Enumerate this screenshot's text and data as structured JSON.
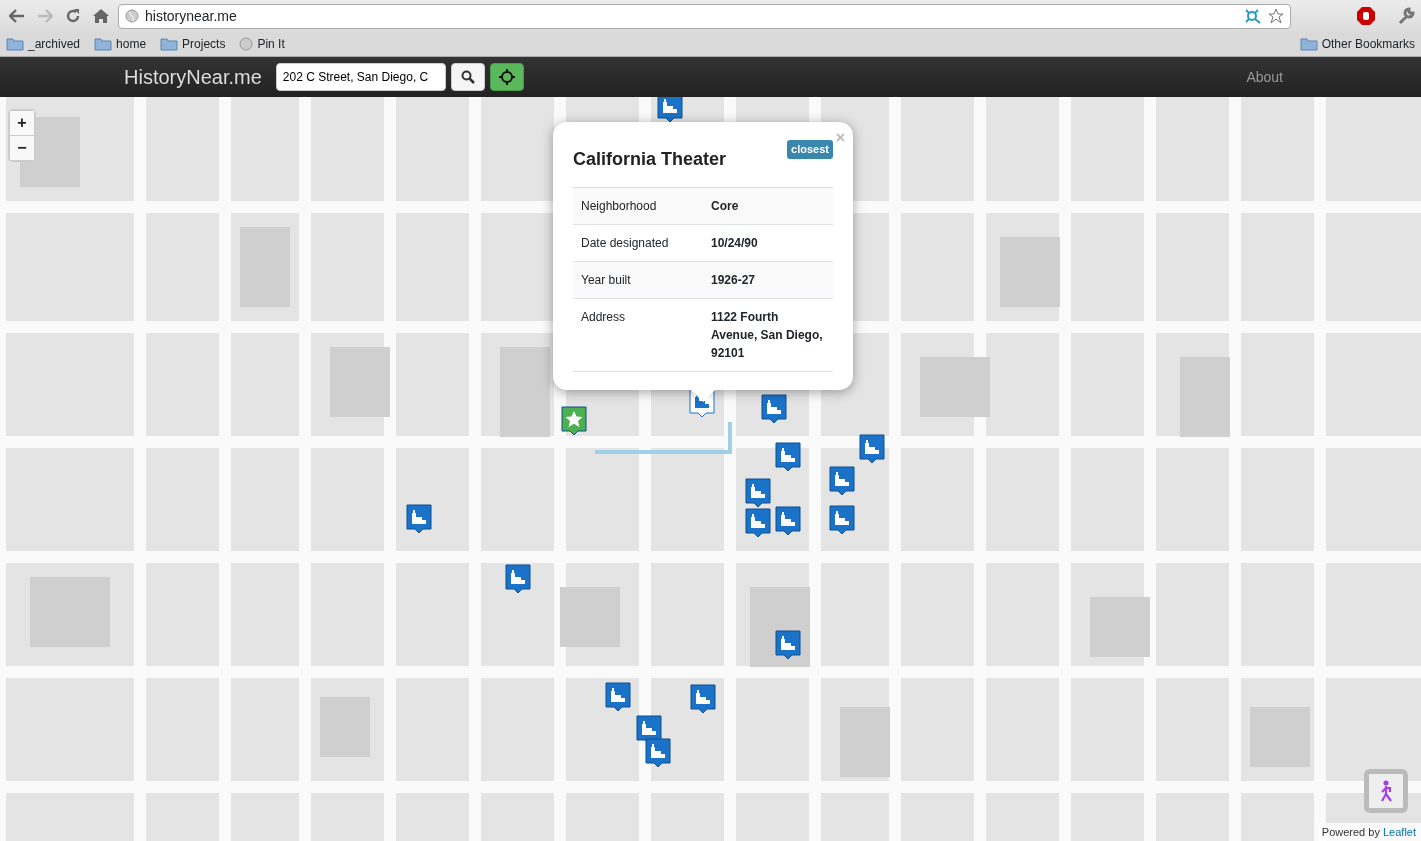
{
  "browser": {
    "url": "historynear.me",
    "bookmarks": [
      {
        "label": "_archived",
        "kind": "folder"
      },
      {
        "label": "home",
        "kind": "folder"
      },
      {
        "label": "Projects",
        "kind": "folder"
      },
      {
        "label": "Pin It",
        "kind": "site"
      }
    ],
    "other_bookmarks": "Other Bookmarks"
  },
  "navbar": {
    "brand": "HistoryNear.me",
    "search": {
      "value": "202 C Street, San Diego, C"
    },
    "about": "About"
  },
  "map": {
    "zoom_in": "+",
    "zoom_out": "−",
    "markers": [
      {
        "kind": "landmark",
        "selected": false
      },
      {
        "kind": "landmark",
        "selected": true
      },
      {
        "kind": "landmark",
        "selected": false
      },
      {
        "kind": "landmark",
        "selected": false
      },
      {
        "kind": "landmark",
        "selected": false
      },
      {
        "kind": "landmark",
        "selected": false
      },
      {
        "kind": "landmark",
        "selected": false
      },
      {
        "kind": "landmark",
        "selected": false
      },
      {
        "kind": "landmark",
        "selected": false
      },
      {
        "kind": "landmark",
        "selected": false
      },
      {
        "kind": "landmark",
        "selected": false
      },
      {
        "kind": "landmark",
        "selected": false
      },
      {
        "kind": "landmark",
        "selected": false
      },
      {
        "kind": "landmark",
        "selected": false
      },
      {
        "kind": "landmark",
        "selected": false
      },
      {
        "kind": "landmark",
        "selected": false
      },
      {
        "kind": "landmark",
        "selected": false
      },
      {
        "kind": "you",
        "selected": false
      }
    ],
    "popup": {
      "title": "California Theater",
      "badge": "closest",
      "close": "×",
      "rows": [
        {
          "label": "Neighborhood",
          "value": "Core"
        },
        {
          "label": "Date designated",
          "value": "10/24/90"
        },
        {
          "label": "Year built",
          "value": "1926-27"
        },
        {
          "label": "Address",
          "value": "1122 Fourth Avenue, San Diego, 92101"
        }
      ]
    },
    "attribution": {
      "text": "Powered by",
      "link": "Leaflet"
    }
  }
}
